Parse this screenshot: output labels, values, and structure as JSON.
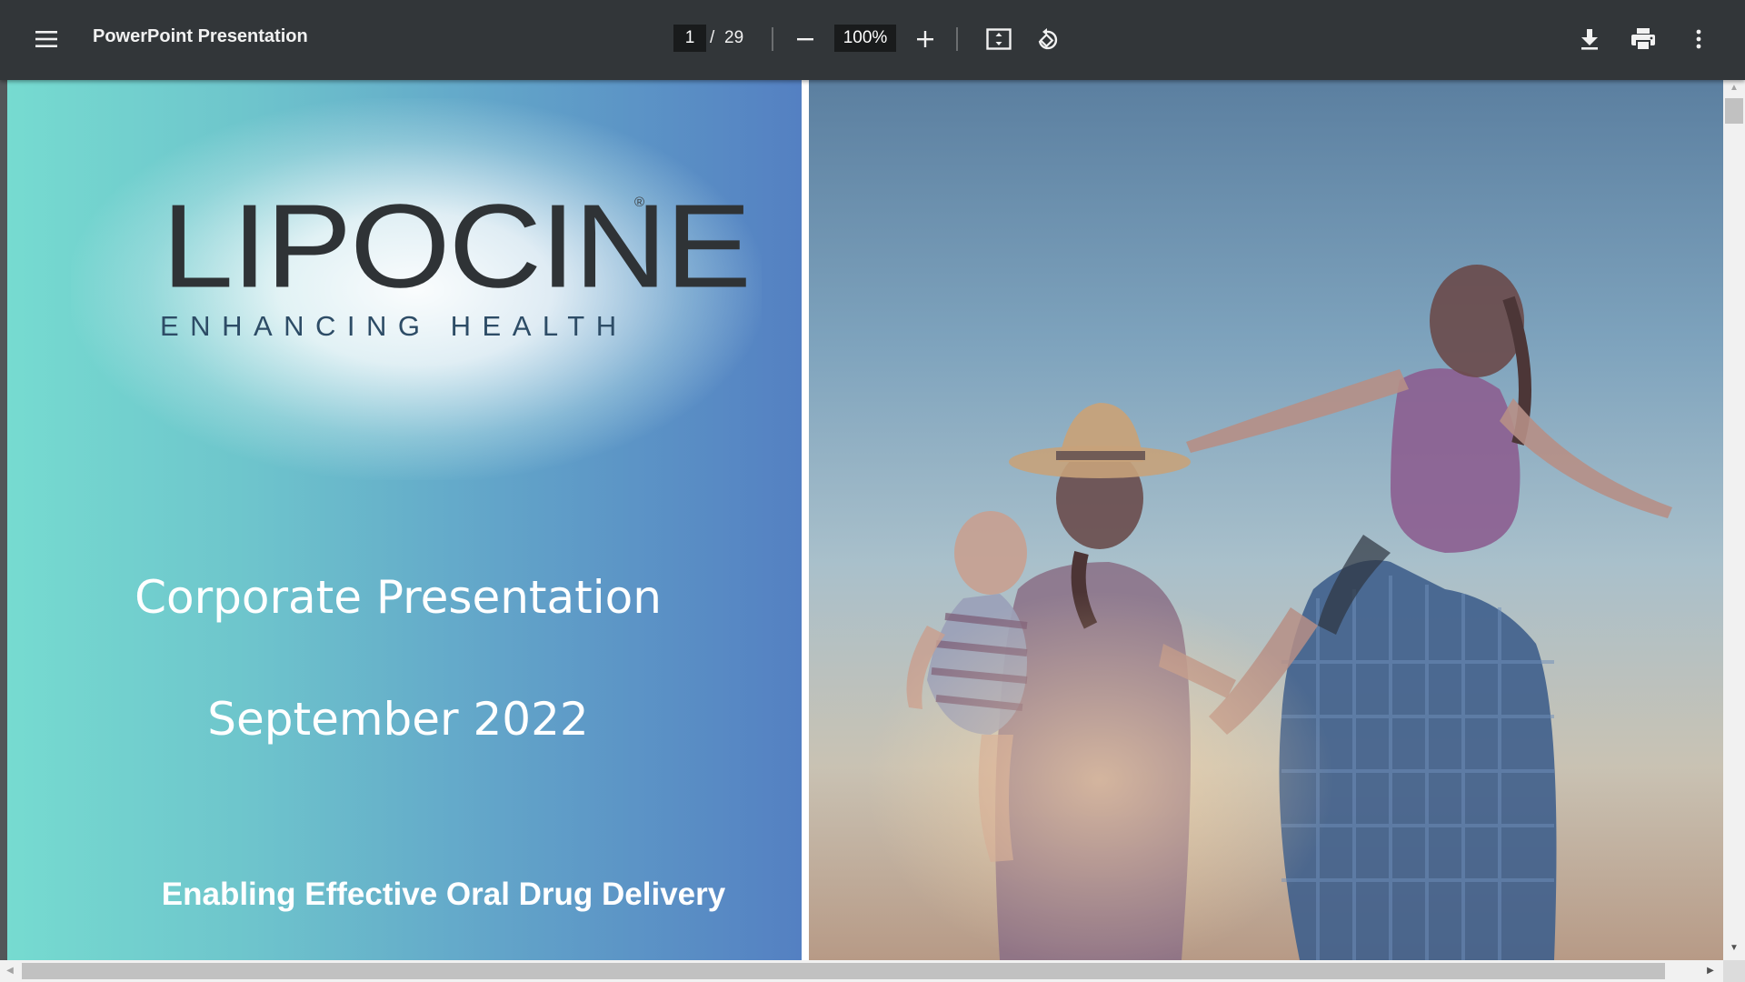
{
  "toolbar": {
    "menu_icon": "hamburger-menu-icon",
    "title": "PowerPoint Presentation",
    "current_page": "1",
    "page_separator": "/",
    "total_pages": "29",
    "zoom": "100%",
    "icons": [
      "minus-icon",
      "plus-icon",
      "fit-to-page-icon",
      "rotate-icon",
      "download-icon",
      "print-icon",
      "more-vert-icon"
    ]
  },
  "slide": {
    "logo_text": "LIPOCINE",
    "logo_reg_mark": "®",
    "logo_tagline": "ENHANCING HEALTH",
    "title": "Corporate Presentation",
    "date": "September 2022",
    "tagline": "Enabling Effective Oral Drug Delivery",
    "photo_subject": "family-silhouette-photo"
  },
  "scrollbars": {
    "vertical_position": 0.0,
    "horizontal_position": 0.0
  }
}
